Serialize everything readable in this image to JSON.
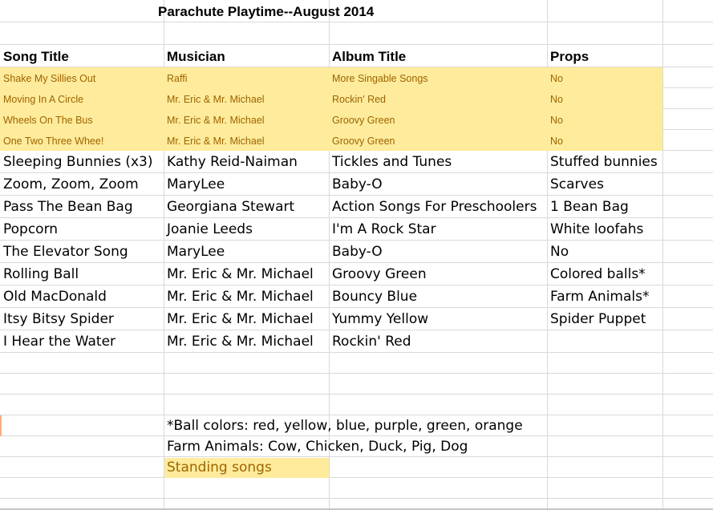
{
  "sheet": {
    "title": "Parachute Playtime--August 2014",
    "headers": [
      "Song Title",
      "Musician",
      "Album Title",
      "Props"
    ],
    "highlighted_rows": [
      [
        "Shake My Sillies Out",
        "Raffi",
        "More Singable Songs",
        "No"
      ],
      [
        "Moving In A Circle",
        "Mr. Eric & Mr. Michael",
        "Rockin' Red",
        "No"
      ],
      [
        "Wheels On The Bus",
        "Mr. Eric & Mr. Michael",
        "Groovy Green",
        "No"
      ],
      [
        "One Two Three Whee!",
        "Mr. Eric & Mr. Michael",
        "Groovy Green",
        "No"
      ]
    ],
    "rows": [
      [
        "Sleeping Bunnies (x3)",
        "Kathy Reid-Naiman",
        "Tickles and Tunes",
        "Stuffed bunnies"
      ],
      [
        "Zoom, Zoom, Zoom",
        "MaryLee",
        "Baby-O",
        "Scarves"
      ],
      [
        "Pass The Bean Bag",
        "Georgiana Stewart",
        "Action Songs For Preschoolers",
        "1 Bean Bag"
      ],
      [
        "Popcorn",
        "Joanie Leeds",
        "I'm A Rock Star",
        "White loofahs"
      ],
      [
        "The Elevator Song",
        "MaryLee",
        "Baby-O",
        "No"
      ],
      [
        "Rolling Ball",
        "Mr. Eric & Mr. Michael",
        "Groovy Green",
        "Colored balls*"
      ],
      [
        "Old MacDonald",
        "Mr. Eric & Mr. Michael",
        "Bouncy Blue",
        "Farm Animals*"
      ],
      [
        "Itsy Bitsy Spider",
        "Mr. Eric & Mr. Michael",
        "Yummy Yellow",
        "Spider Puppet"
      ],
      [
        "I Hear the Water",
        "Mr. Eric & Mr. Michael",
        "Rockin' Red",
        ""
      ]
    ],
    "notes": [
      "*Ball colors: red, yellow, blue, purple, green, orange",
      "Farm Animals: Cow, Chicken, Duck, Pig, Dog",
      "Standing songs"
    ],
    "colors": {
      "highlight_fill": "#ffeb9c",
      "highlight_text": "#9c6500",
      "gridline": "#d9d9d9"
    }
  }
}
